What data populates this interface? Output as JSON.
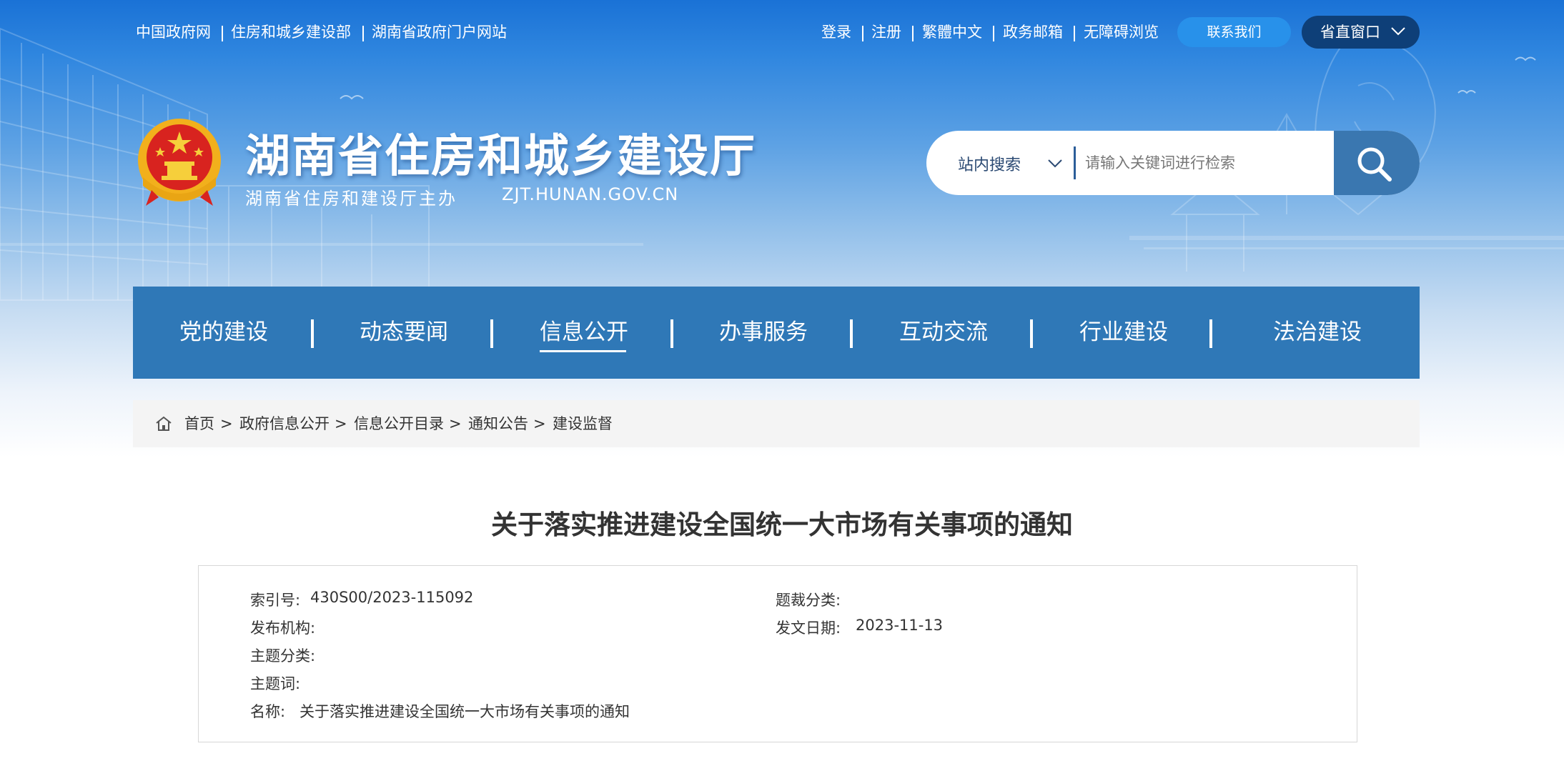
{
  "top_bar": {
    "left_links": [
      "中国政府网",
      "住房和城乡建设部",
      "湖南省政府门户网站"
    ],
    "right_links": [
      "登录",
      "注册",
      "繁體中文",
      "政务邮箱",
      "无障碍浏览"
    ],
    "contact_label": "联系我们",
    "province_label": "省直窗口"
  },
  "header": {
    "site_title": "湖南省住房和城乡建设厅",
    "site_subtitle": "湖南省住房和建设厅主办",
    "site_domain": "ZJT.HUNAN.GOV.CN"
  },
  "search": {
    "scope_label": "站内搜索",
    "placeholder": "请输入关键词进行检索"
  },
  "nav": {
    "items": [
      "党的建设",
      "动态要闻",
      "信息公开",
      "办事服务",
      "互动交流",
      "行业建设",
      "法治建设"
    ],
    "active": "信息公开"
  },
  "breadcrumb": {
    "items": [
      "首页",
      "政府信息公开",
      "信息公开目录",
      "通知公告",
      "建设监督"
    ],
    "separator": ">"
  },
  "article": {
    "title": "关于落实推进建设全国统一大市场有关事项的通知",
    "meta": {
      "index_no_label": "索引号:",
      "index_no": "430S00/2023-115092",
      "genre_label": "题裁分类:",
      "genre": "",
      "issuer_label": "发布机构:",
      "issuer": "",
      "date_label": "发文日期:",
      "date": "2023-11-13",
      "topic_label": "主题分类:",
      "topic": "",
      "keywords_label": "主题词:",
      "keywords": "",
      "name_label": "名称:",
      "name": "关于落实推进建设全国统一大市场有关事项的通知"
    }
  },
  "colors": {
    "nav_bg": "#2f78b7",
    "header_blue": "#1a72d6",
    "contact_btn": "#2891ea",
    "province_btn": "#0e3f78",
    "search_btn": "#3a77b0",
    "breadcrumb_bg": "#f4f4f4"
  },
  "icons": [
    "national-emblem-icon",
    "search-icon",
    "home-icon",
    "chevron-down-icon"
  ]
}
